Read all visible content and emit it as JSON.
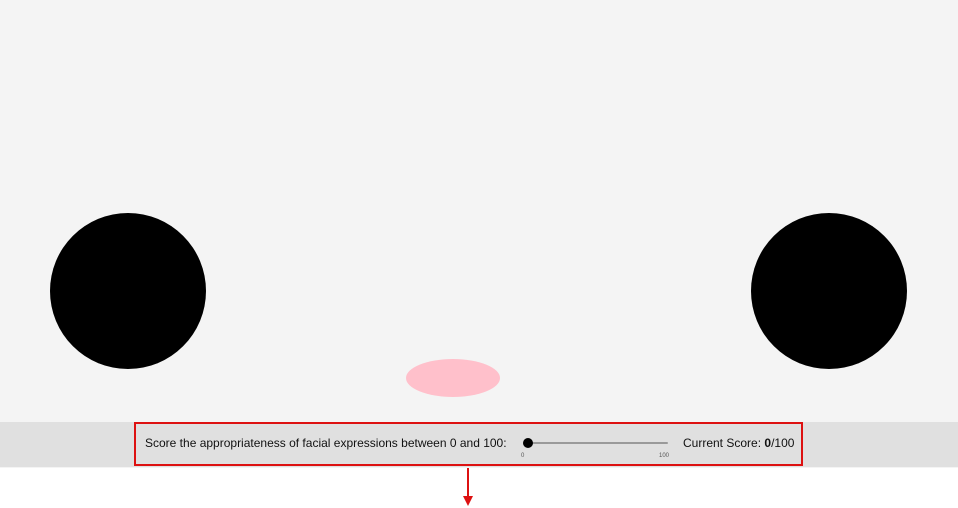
{
  "prompt_text": "Score the appropriateness of facial expressions between 0 and 100:",
  "slider": {
    "min_label": "0",
    "max_label": "100",
    "value_fraction": 0
  },
  "score": {
    "label": "Current Score: ",
    "value": "0",
    "max": "/100"
  },
  "colors": {
    "background": "#f4f4f4",
    "eyes": "#000000",
    "mouth": "#ffc0cb",
    "bar": "#e0e0e0",
    "highlight": "#dd1111"
  }
}
